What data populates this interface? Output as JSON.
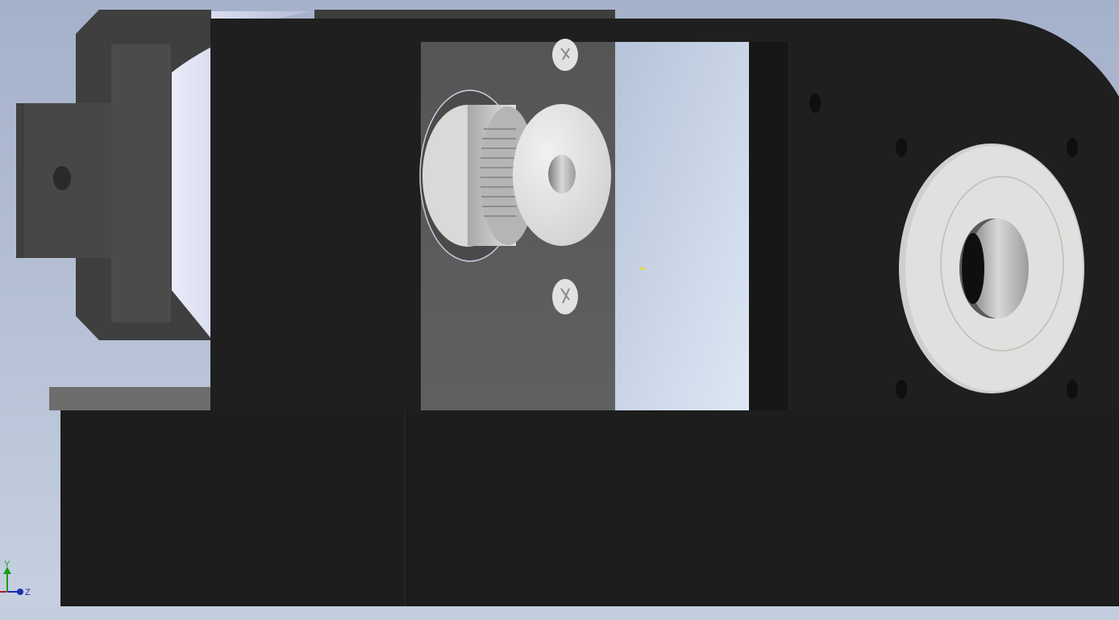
{
  "viewport": {
    "background_top": "#a7b3cc",
    "background_bottom": "#c9d2e2"
  },
  "colors": {
    "plate_dark": "#1e1e1e",
    "plate_darker": "#151515",
    "motor_body": "#4a4a4a",
    "motor_face": "#3a3a3a",
    "motor_flange_light": "#c9cde2",
    "bracket_grey": "#5a5a5a",
    "pulley_white": "#e6e6e4",
    "bearing_white": "#dcdcda",
    "base_strip": "#6c6c6c",
    "axis_y": "#1a9c1a",
    "axis_z": "#1a2fb0",
    "axis_x": "#b01a1a"
  },
  "triad": {
    "y_label": "Y",
    "z_label": "Z"
  },
  "parts": {
    "motor": "stepper-motor",
    "bracket": "motor-bracket",
    "pulley": "timing-pulley",
    "bearing": "flange-bearing",
    "frame": "main-plate"
  }
}
